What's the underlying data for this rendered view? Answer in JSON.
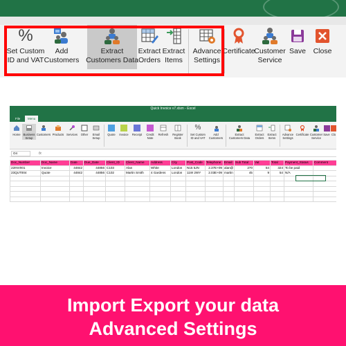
{
  "zoom_ribbon": {
    "buttons": [
      {
        "label": "Set Custom\nID and VAT",
        "icon": "percent-icon"
      },
      {
        "label": "Add\nCustomers",
        "icon": "add-customers-icon"
      },
      {
        "label": "Extract\nCustomers Data",
        "icon": "extract-customers-icon"
      },
      {
        "label": "Extract\nOrders",
        "icon": "extract-orders-icon"
      },
      {
        "label": "Extract\nItems",
        "icon": "extract-items-icon"
      },
      {
        "label": "Advance\nSettings",
        "icon": "advance-settings-icon"
      },
      {
        "label": "Certificate",
        "icon": "certificate-icon"
      },
      {
        "label": "Customer\nService",
        "icon": "customer-service-icon"
      },
      {
        "label": "Save",
        "icon": "save-icon"
      },
      {
        "label": "Close",
        "icon": "close-icon"
      }
    ],
    "highlight_color": "#ff0000"
  },
  "excel": {
    "title": "Quick Invoice v7.xlsm - Excel",
    "tabs": [
      "File",
      "Menu"
    ],
    "ribbon_buttons": [
      "Home",
      "Business\nSetup",
      "Customers",
      "Products",
      "Services",
      "Other",
      "Email\nSetup",
      "Quote",
      "Invoice",
      "Receipt",
      "Credit\nNote",
      "Refresh",
      "Register\nBook",
      "Set Custom\nID and VAT",
      "Add\nCustomers",
      "Extract\nCustomers Data",
      "Extract\nOrders",
      "Extract\nItems",
      "Advance\nSettings",
      "Certificate",
      "Customer\nService",
      "Save",
      "Clo"
    ],
    "name_box": "O4",
    "fx": "fx",
    "columns": [
      "Doc_Number",
      "Doc_Name",
      "Date",
      "Due_Date",
      "Client_ID",
      "Client_Name",
      "Address",
      "City",
      "Post_Code",
      "Telephone",
      "Email",
      "Sub Total",
      "Vat",
      "Total",
      "Payment_Status",
      "Comment"
    ],
    "rows": [
      [
        "22INV001",
        "Invoice",
        "44842",
        "44856",
        "C103",
        "Alan",
        "White",
        "London",
        "N15 5JN",
        "2.37E+09",
        "alan@",
        "270",
        "54",
        "324",
        "To be paid",
        ""
      ],
      [
        "23QUT004",
        "Quote",
        "44842",
        "44856",
        "C102",
        "Martin Smith",
        "4 Gardens",
        "London",
        "11W 2WY",
        "2.03E+09",
        "martin",
        "45",
        "9",
        "54",
        "N/A",
        ""
      ]
    ],
    "header_color": "#ff3d95"
  },
  "banner": {
    "line1": "Import Export your data",
    "line2": "Advanced Settings",
    "color": "#ff1170"
  }
}
